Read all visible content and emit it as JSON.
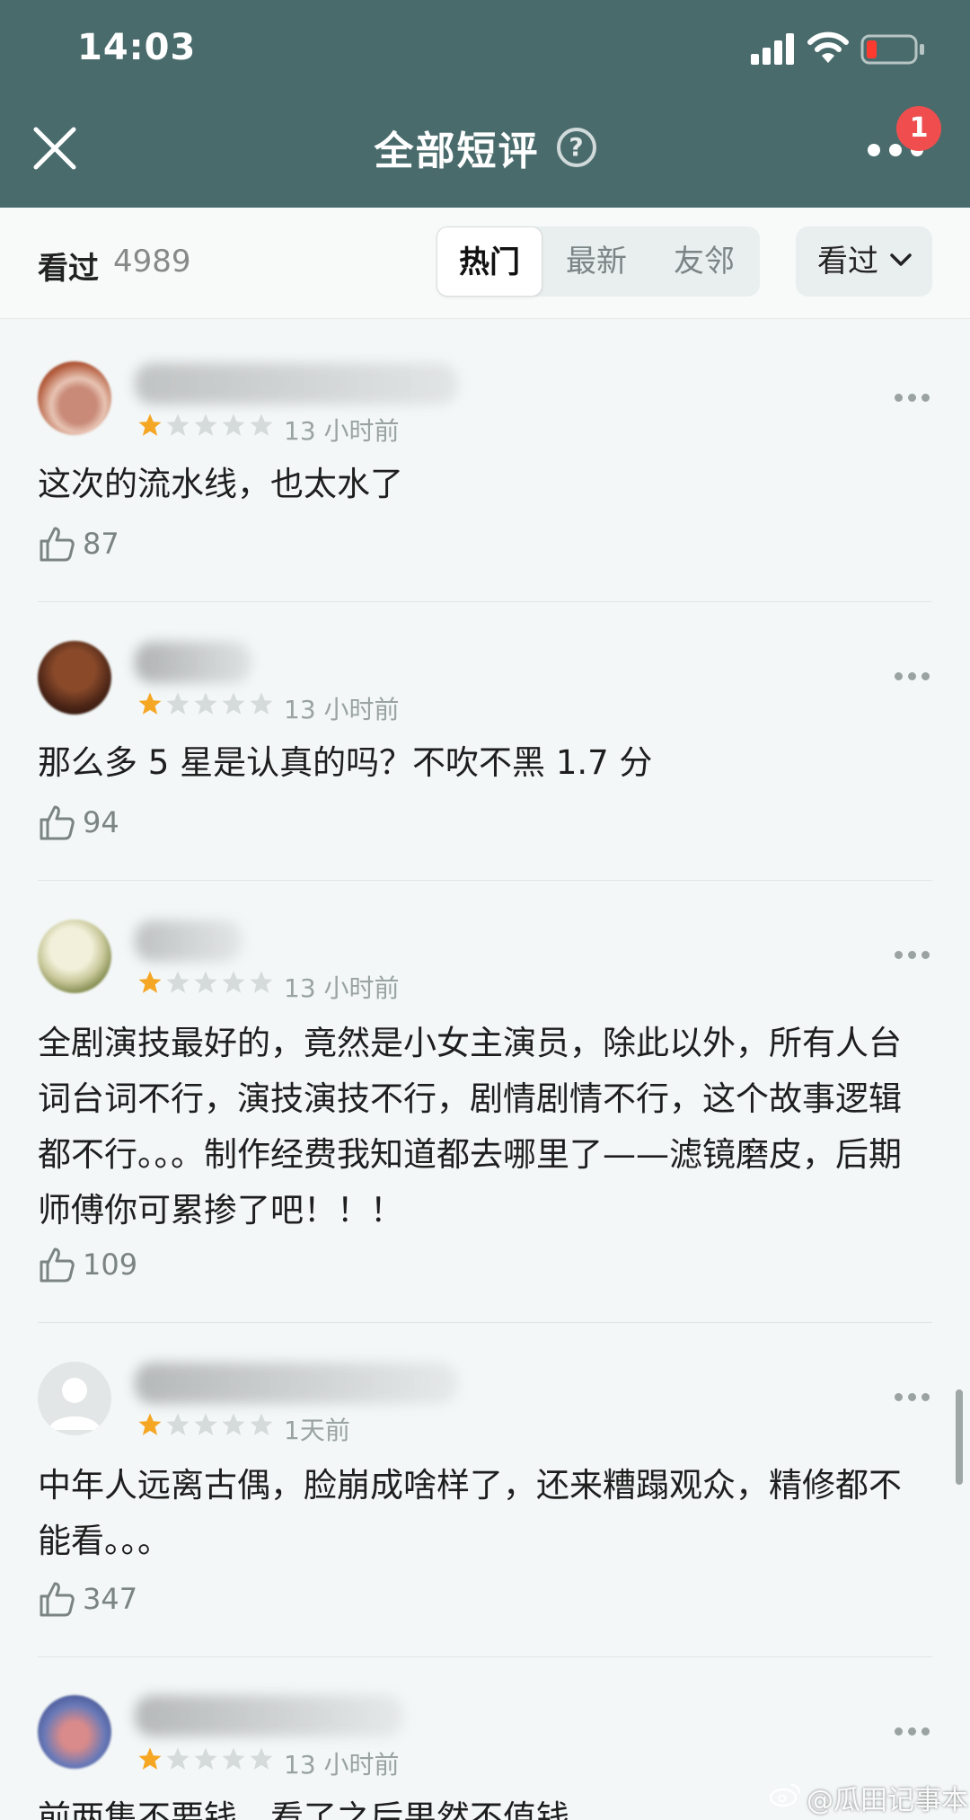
{
  "status_bar": {
    "time": "14:03"
  },
  "header": {
    "title": "全部短评",
    "help_glyph": "?",
    "notification_badge": "1"
  },
  "filter": {
    "watched_label": "看过",
    "watched_count": "4989",
    "tabs": [
      {
        "label": "热门",
        "active": true
      },
      {
        "label": "最新",
        "active": false
      },
      {
        "label": "友邻",
        "active": false
      }
    ],
    "dropdown_label": "看过"
  },
  "reviews": [
    {
      "username": "",
      "rating": 1,
      "time": "13 小时前",
      "content": "这次的流水线，也太水了",
      "likes": "87"
    },
    {
      "username": "",
      "rating": 1,
      "time": "13 小时前",
      "content": "那么多 5 星是认真的吗？不吹不黑 1.7 分",
      "likes": "94"
    },
    {
      "username": "",
      "rating": 1,
      "time": "13 小时前",
      "content": "全剧演技最好的，竟然是小女主演员，除此以外，所有人台词台词不行，演技演技不行，剧情剧情不行，这个故事逻辑都不行。。。制作经费我知道都去哪里了——滤镜磨皮，后期师傅你可累掺了吧！！！",
      "likes": "109"
    },
    {
      "username": "",
      "rating": 1,
      "time": "1天前",
      "content": "中年人远离古偶，脸崩成啥样了，还来糟蹋观众，精修都不能看。。。",
      "likes": "347"
    },
    {
      "username": "",
      "rating": 1,
      "time": "13 小时前",
      "content": "前两集不要钱，看了之后果然不值钱",
      "likes": ""
    }
  ],
  "watermark": "@瓜田记事本",
  "colors": {
    "header_bg": "#4a6b6c",
    "star_active": "#f5a623",
    "star_inactive": "#d5dada",
    "badge": "#f04e4e"
  }
}
